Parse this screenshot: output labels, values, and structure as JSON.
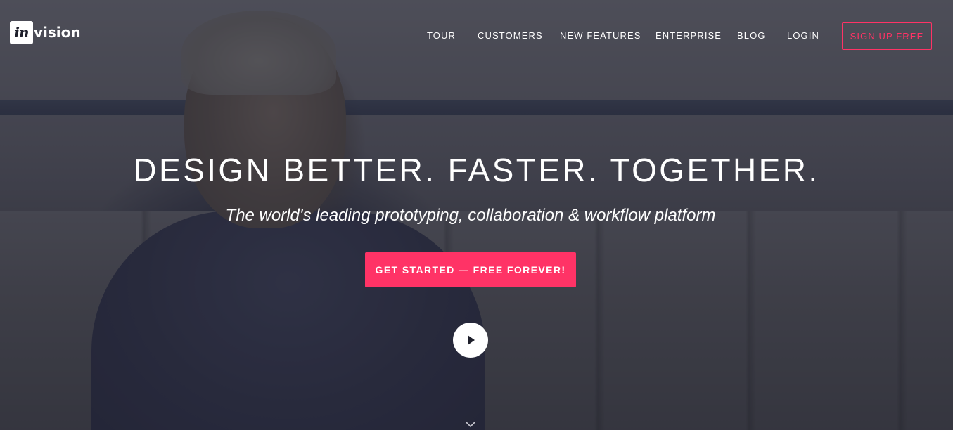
{
  "brand": {
    "logo_mark": "in",
    "logo_text": "vision",
    "accent_color": "#ff3366"
  },
  "nav": {
    "items": [
      {
        "label": "TOUR"
      },
      {
        "label": "CUSTOMERS"
      },
      {
        "label": "NEW FEATURES"
      },
      {
        "label": "ENTERPRISE"
      },
      {
        "label": "BLOG"
      },
      {
        "label": "LOGIN"
      }
    ],
    "cta_label": "SIGN UP FREE"
  },
  "hero": {
    "headline": "DESIGN BETTER. FASTER. TOGETHER.",
    "subheadline": "The world's leading prototyping, collaboration & workflow platform",
    "cta_label": "GET STARTED — FREE FOREVER!",
    "play_icon": "play-icon",
    "scroll_icon": "chevron-down-icon"
  }
}
